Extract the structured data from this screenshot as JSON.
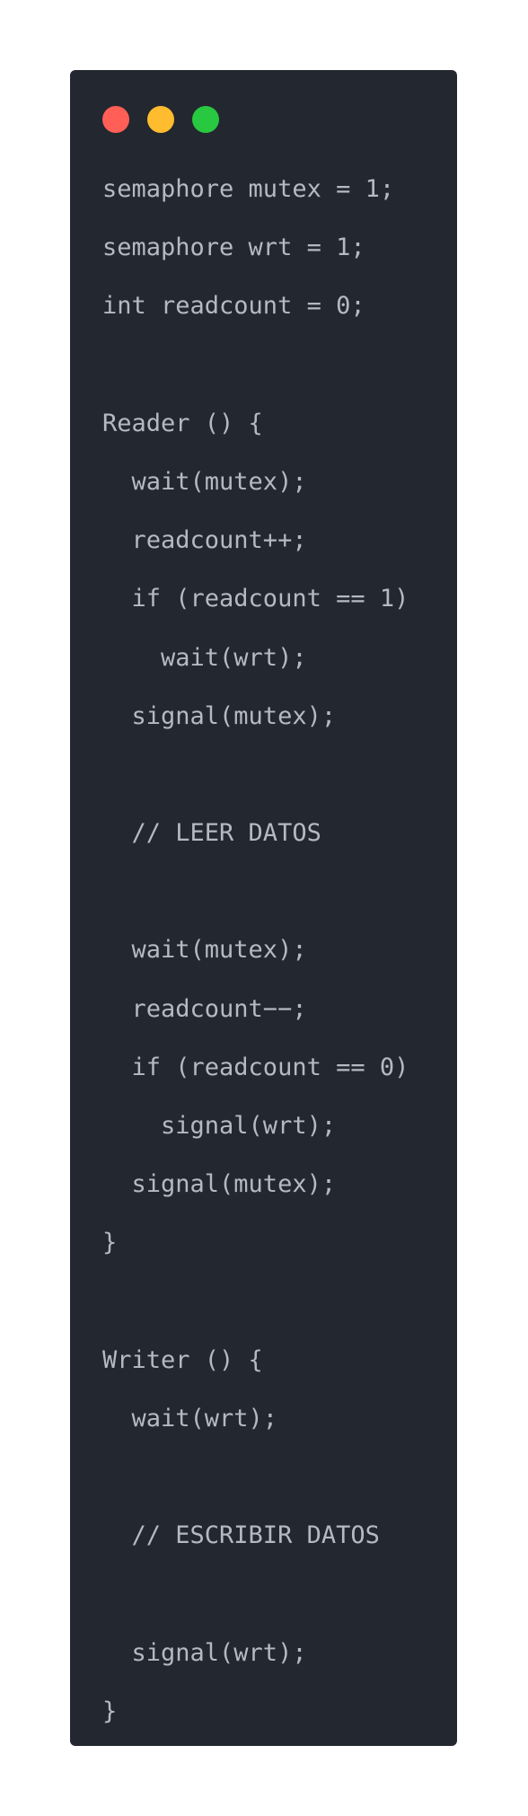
{
  "window": {
    "background": "#23272f",
    "controls": [
      {
        "name": "close",
        "color": "#ff5f57"
      },
      {
        "name": "minimize",
        "color": "#febc2e"
      },
      {
        "name": "maximize",
        "color": "#28c840"
      }
    ]
  },
  "code": {
    "text_color": "#b5b9c2",
    "lines": [
      "semaphore mutex = 1;",
      "semaphore wrt = 1;",
      "int readcount = 0;",
      "",
      "Reader () {",
      "  wait(mutex);",
      "  readcount++;",
      "  if (readcount == 1)",
      "    wait(wrt);",
      "  signal(mutex);",
      "",
      "  // LEER DATOS",
      "",
      "  wait(mutex);",
      "  readcount−−;",
      "  if (readcount == 0)",
      "    signal(wrt);",
      "  signal(mutex);",
      "}",
      "",
      "Writer () {",
      "  wait(wrt);",
      "",
      "  // ESCRIBIR DATOS",
      "",
      "  signal(wrt);",
      "}"
    ]
  }
}
